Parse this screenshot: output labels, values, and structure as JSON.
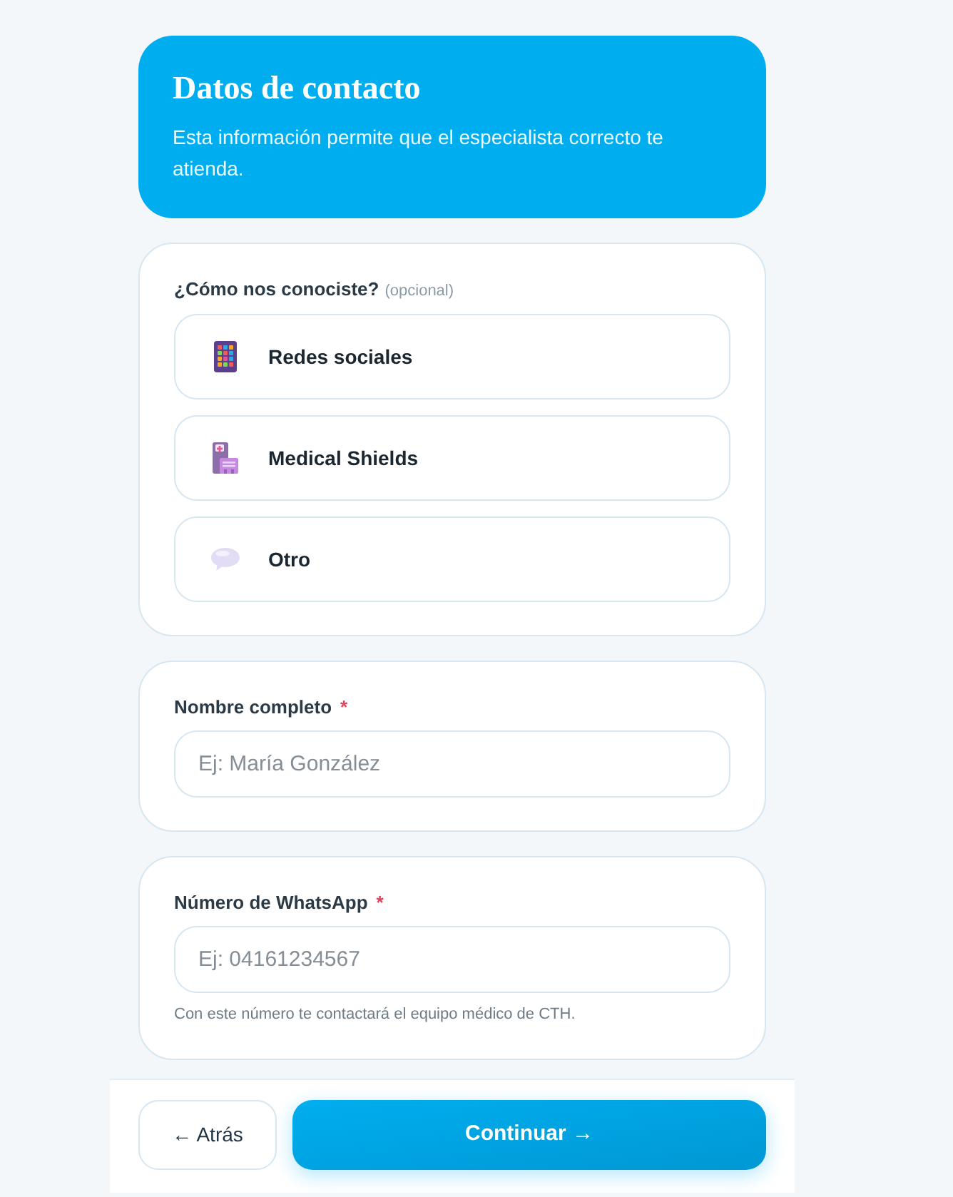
{
  "header": {
    "title": "Datos de contacto",
    "subtitle": "Esta información permite que el especialista correcto te atienda."
  },
  "referral": {
    "label": "¿Cómo nos conociste?",
    "hint": "(opcional)",
    "options": [
      {
        "label": "Redes sociales",
        "selected": false
      },
      {
        "label": "Medical Shields",
        "selected": false
      },
      {
        "label": "Otro",
        "selected": false
      }
    ]
  },
  "fields": [
    {
      "label": "Nombre completo",
      "required_mark": "*",
      "placeholder": "Ej: María González"
    },
    {
      "label": "Número de WhatsApp",
      "required_mark": "*",
      "placeholder": "Ej: 04161234567",
      "help": "Con este número te contactará el equipo médico de CTH."
    }
  ],
  "footer": {
    "back": "← Atrás",
    "next": "Continuar →"
  }
}
